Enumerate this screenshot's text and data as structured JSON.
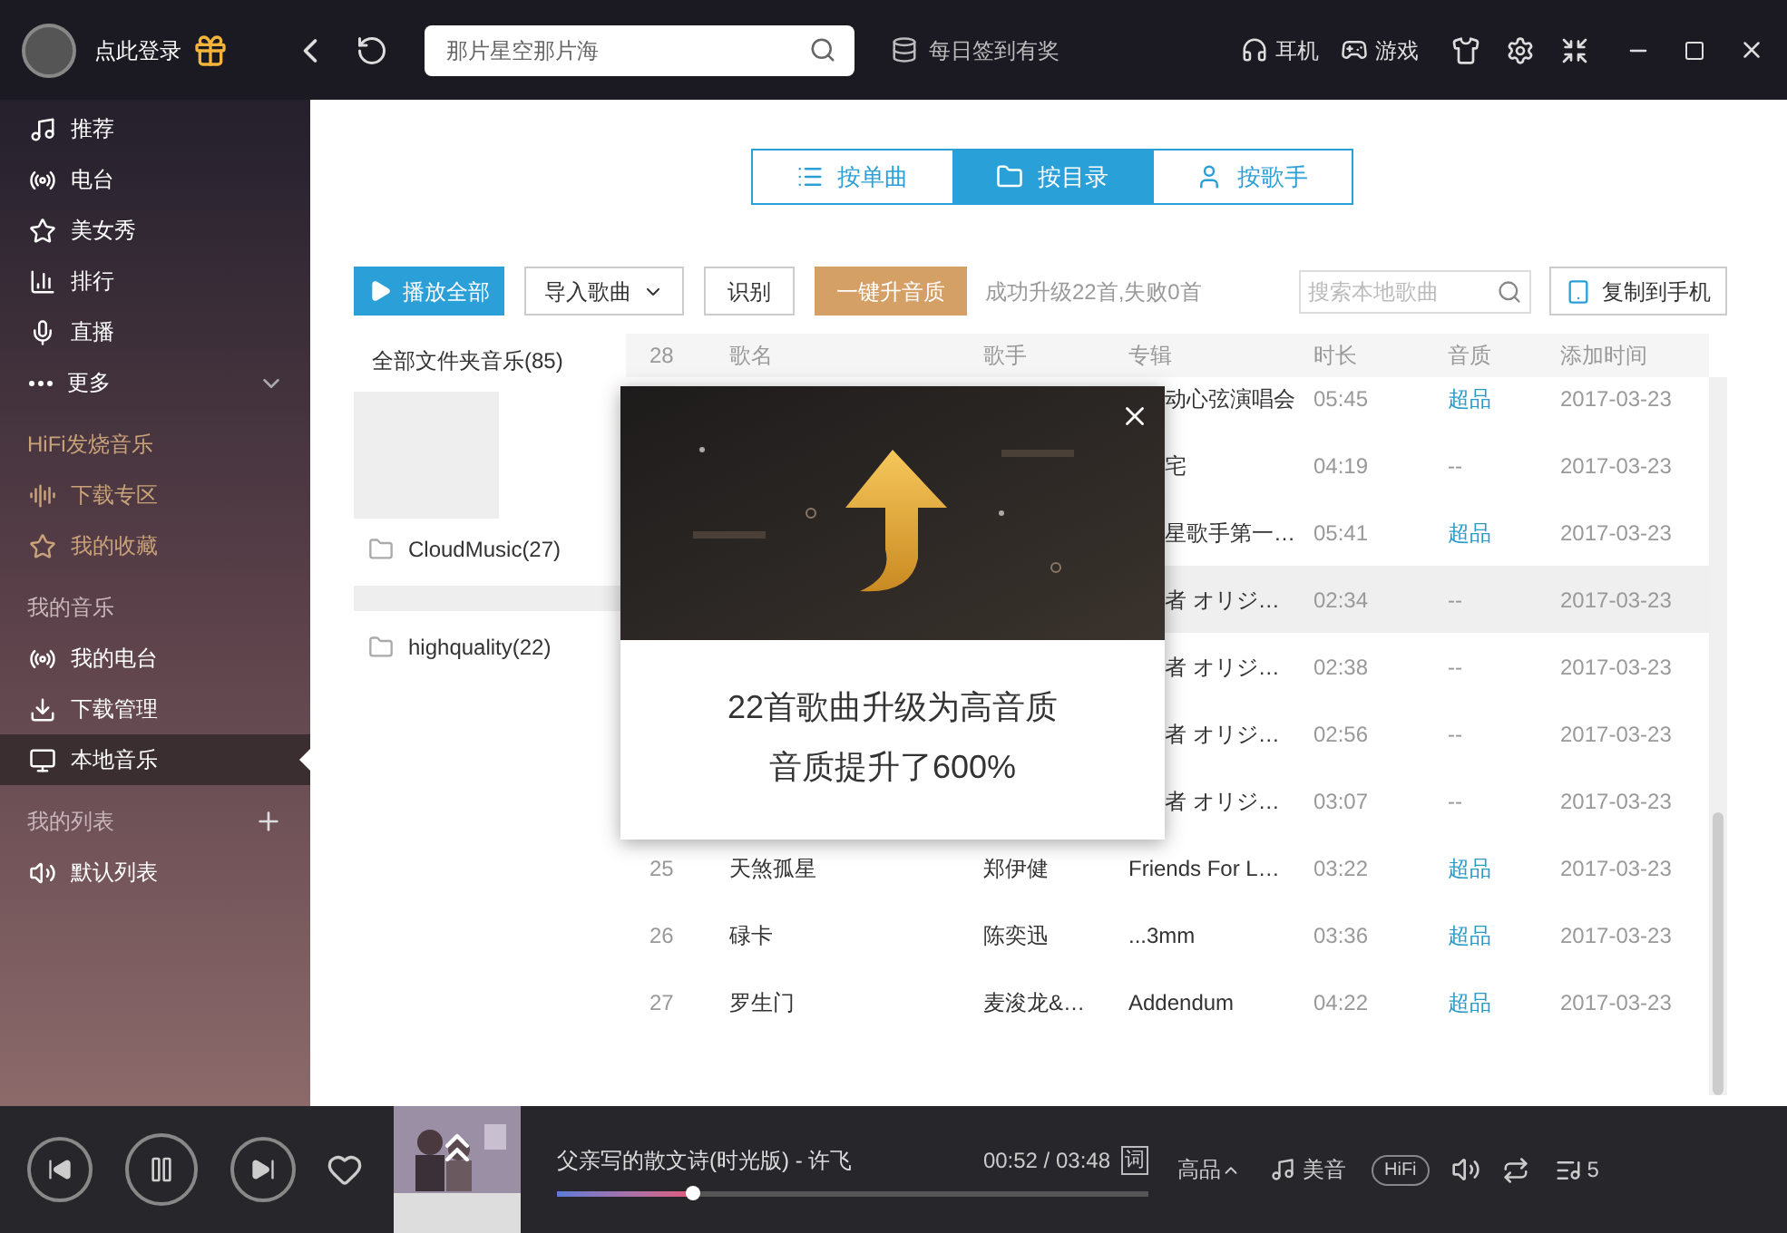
{
  "account": {
    "login": "点此登录"
  },
  "search": {
    "placeholder": "那片星空那片海"
  },
  "checkin": "每日签到有奖",
  "top_links": [
    {
      "kind": "headphones",
      "label": "耳机"
    },
    {
      "kind": "game",
      "label": "游戏"
    }
  ],
  "sidebar": {
    "groups": [
      {
        "items": [
          {
            "kind": "music",
            "label": "推荐",
            "selected": false
          },
          {
            "kind": "radio",
            "label": "电台",
            "selected": false
          },
          {
            "kind": "star",
            "label": "美女秀",
            "selected": false
          },
          {
            "kind": "chart",
            "label": "排行",
            "selected": false
          },
          {
            "kind": "mic",
            "label": "直播",
            "selected": false
          },
          {
            "kind": "more",
            "label": "更多",
            "selected": false
          }
        ]
      },
      {
        "title": "HiFi发烧音乐",
        "hifi": true,
        "items": [
          {
            "kind": "wave",
            "label": "下载专区",
            "selected": false
          },
          {
            "kind": "star",
            "label": "我的收藏",
            "selected": false
          }
        ]
      },
      {
        "title": "我的音乐",
        "hifi": false,
        "items": [
          {
            "kind": "radio2",
            "label": "我的电台",
            "selected": false
          },
          {
            "kind": "download",
            "label": "下载管理",
            "selected": false
          },
          {
            "kind": "monitor",
            "label": "本地音乐",
            "selected": true
          }
        ]
      },
      {
        "title": "我的列表",
        "hifi": false,
        "add": true,
        "items": [
          {
            "kind": "speaker",
            "label": "默认列表",
            "selected": false
          }
        ]
      }
    ]
  },
  "view_tabs": [
    {
      "kind": "list",
      "label": "按单曲",
      "selected": false
    },
    {
      "kind": "folder",
      "label": "按目录",
      "selected": true
    },
    {
      "kind": "user",
      "label": "按歌手",
      "selected": false
    }
  ],
  "toolbar": {
    "play_all": "播放全部",
    "import": "导入歌曲",
    "identify": "识别",
    "upgrade": "一键升音质",
    "status": "成功升级22首,失败0首",
    "search_placeholder": "搜索本地歌曲",
    "copy": "复制到手机"
  },
  "folders": [
    {
      "kind": "all",
      "label": "全部文件夹音乐(85)"
    },
    {
      "kind": "blurred"
    },
    {
      "kind": "folder",
      "label": "CloudMusic(27)"
    },
    {
      "kind": "blurred"
    },
    {
      "kind": "folder",
      "label": "highquality(22)"
    }
  ],
  "table": {
    "columns": [
      "28",
      "歌名",
      "歌手",
      "专辑",
      "时长",
      "音质",
      "添加时间"
    ],
    "rows": [
      {
        "covered": true,
        "album": "动心弦演唱会",
        "duration": "05:45",
        "quality": "超品",
        "super": true,
        "date": "2017-03-23",
        "selected": false
      },
      {
        "covered": true,
        "album": "宅",
        "duration": "04:19",
        "quality": "--",
        "super": false,
        "date": "2017-03-23",
        "selected": false
      },
      {
        "covered": true,
        "album": "星歌手第一…",
        "duration": "05:41",
        "quality": "超品",
        "super": true,
        "date": "2017-03-23",
        "selected": false
      },
      {
        "covered": true,
        "album": "者 オリジ…",
        "duration": "02:34",
        "quality": "--",
        "super": false,
        "date": "2017-03-23",
        "selected": true
      },
      {
        "covered": true,
        "album": "者 オリジ…",
        "duration": "02:38",
        "quality": "--",
        "super": false,
        "date": "2017-03-23",
        "selected": false
      },
      {
        "covered": true,
        "album": "者 オリジ…",
        "duration": "02:56",
        "quality": "--",
        "super": false,
        "date": "2017-03-23",
        "selected": false
      },
      {
        "covered": true,
        "album": "者 オリジ…",
        "duration": "03:07",
        "quality": "--",
        "super": false,
        "date": "2017-03-23",
        "selected": false
      },
      {
        "covered": false,
        "num": "25",
        "title": "天煞孤星",
        "artist": "郑伊健",
        "album": "Friends For L…",
        "duration": "03:22",
        "quality": "超品",
        "super": true,
        "date": "2017-03-23",
        "selected": false
      },
      {
        "covered": false,
        "num": "26",
        "title": "碌卡",
        "artist": "陈奕迅",
        "album": "...3mm",
        "duration": "03:36",
        "quality": "超品",
        "super": true,
        "date": "2017-03-23",
        "selected": false
      },
      {
        "covered": false,
        "num": "27",
        "title": "罗生门",
        "artist": "麦浚龙&…",
        "album": "Addendum",
        "duration": "04:22",
        "quality": "超品",
        "super": true,
        "date": "2017-03-23",
        "selected": false
      }
    ]
  },
  "popup": {
    "lines": [
      "22首歌曲升级为高音质",
      "音质提升了600%"
    ]
  },
  "player": {
    "song": "父亲写的散文诗(时光版) - 许飞",
    "time": "00:52 / 03:48",
    "lyrics": "词",
    "level": 0.23,
    "quality": "高品",
    "effect": "美音",
    "hifi": "HiFi",
    "count": "5"
  }
}
